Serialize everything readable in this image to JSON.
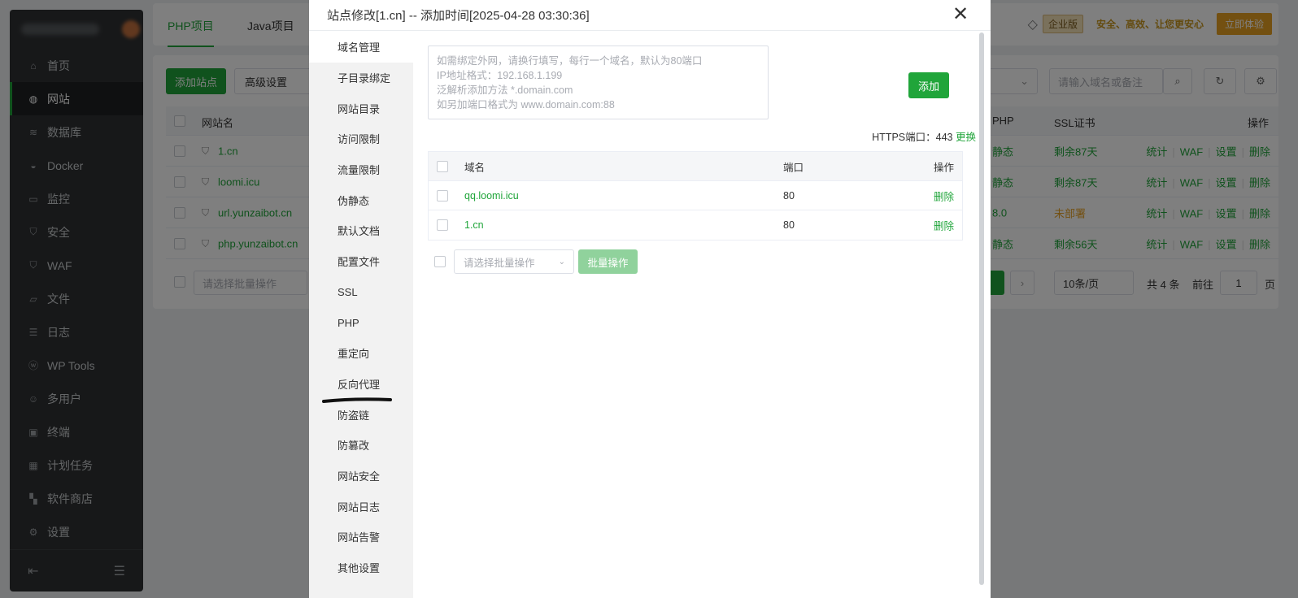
{
  "sidebar": {
    "items": [
      {
        "label": "首页",
        "icon": "home-icon"
      },
      {
        "label": "网站",
        "icon": "globe-icon",
        "active": true
      },
      {
        "label": "数据库",
        "icon": "database-icon"
      },
      {
        "label": "Docker",
        "icon": "docker-icon"
      },
      {
        "label": "监控",
        "icon": "monitor-icon"
      },
      {
        "label": "安全",
        "icon": "shield-icon"
      },
      {
        "label": "WAF",
        "icon": "waf-shield-icon"
      },
      {
        "label": "文件",
        "icon": "folder-icon"
      },
      {
        "label": "日志",
        "icon": "log-icon"
      },
      {
        "label": "WP Tools",
        "icon": "wordpress-icon"
      },
      {
        "label": "多用户",
        "icon": "users-icon"
      },
      {
        "label": "终端",
        "icon": "terminal-icon"
      },
      {
        "label": "计划任务",
        "icon": "calendar-icon"
      },
      {
        "label": "软件商店",
        "icon": "apps-icon"
      },
      {
        "label": "设置",
        "icon": "gear-icon"
      }
    ]
  },
  "topbar": {
    "tabs": [
      "PHP项目",
      "Java项目"
    ],
    "enterprise_badge": "企业版",
    "slogan": "安全、高效、让您更安心",
    "try_button": "立即体验"
  },
  "toolbar": {
    "add_site": "添加站点",
    "advanced": "高级设置",
    "search_placeholder": "请输入域名或备注"
  },
  "site_table": {
    "headers": {
      "name": "网站名",
      "php": "PHP",
      "ssl": "SSL证书",
      "ops": "操作"
    },
    "rows": [
      {
        "name": "1.cn",
        "php": "静态",
        "ssl": "剩余87天",
        "ssl_warn": false
      },
      {
        "name": "loomi.icu",
        "php": "静态",
        "ssl": "剩余87天",
        "ssl_warn": false
      },
      {
        "name": "url.yunzaibot.cn",
        "php": "8.0",
        "ssl": "未部署",
        "ssl_warn": true
      },
      {
        "name": "php.yunzaibot.cn",
        "php": "静态",
        "ssl": "剩余56天",
        "ssl_warn": false
      }
    ],
    "row_actions": [
      "统计",
      "WAF",
      "设置",
      "删除"
    ],
    "batch_placeholder": "请选择批量操作"
  },
  "pagination": {
    "page_size": "10条/页",
    "total": "共 4 条",
    "goto_label": "前往",
    "page": "1",
    "page_suffix": "页"
  },
  "modal": {
    "title": "站点修改[1.cn] -- 添加时间[2025-04-28 03:30:36]",
    "menu": [
      "域名管理",
      "子目录绑定",
      "网站目录",
      "访问限制",
      "流量限制",
      "伪静态",
      "默认文档",
      "配置文件",
      "SSL",
      "PHP",
      "重定向",
      "反向代理",
      "防盗链",
      "防篡改",
      "网站安全",
      "网站日志",
      "网站告警",
      "其他设置"
    ],
    "active_menu": 0,
    "placeholder_lines": [
      "如需绑定外网，请换行填写，每行一个域名，默认为80端口",
      "IP地址格式：192.168.1.199",
      "泛解析添加方法 *.domain.com",
      "如另加端口格式为 www.domain.com:88"
    ],
    "add_button": "添加",
    "https_label": "HTTPS端口：443",
    "https_change": "更换",
    "table_headers": {
      "domain": "域名",
      "port": "端口",
      "ops": "操作"
    },
    "rows": [
      {
        "domain": "qq.loomi.icu",
        "port": "80",
        "action": "删除"
      },
      {
        "domain": "1.cn",
        "port": "80",
        "action": "删除"
      }
    ],
    "batch_placeholder": "请选择批量操作",
    "batch_button": "批量操作"
  },
  "colors": {
    "accent": "#20a53a",
    "warn": "#e6a023",
    "sidebar_bg": "#2f3133"
  }
}
